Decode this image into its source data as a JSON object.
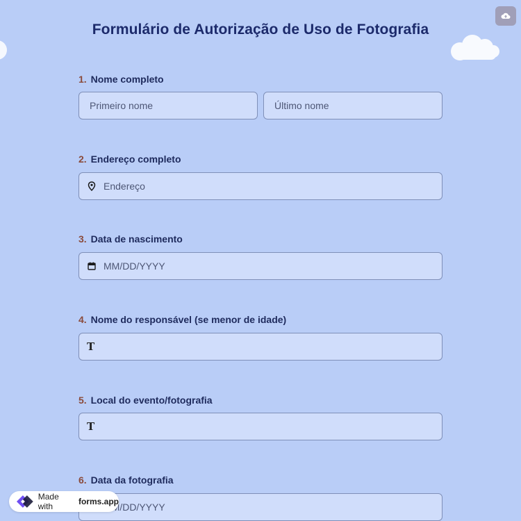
{
  "form": {
    "title": "Formulário de Autorização de Uso de Fotografia"
  },
  "questions": [
    {
      "num": "1.",
      "label": "Nome completo",
      "first_placeholder": "Primeiro nome",
      "last_placeholder": "Último nome"
    },
    {
      "num": "2.",
      "label": "Endereço completo",
      "placeholder": "Endereço",
      "icon": "location-pin-icon"
    },
    {
      "num": "3.",
      "label": "Data de nascimento",
      "placeholder": "MM/DD/YYYY",
      "icon": "calendar-icon"
    },
    {
      "num": "4.",
      "label": "Nome do responsável (se menor de idade)",
      "placeholder": "",
      "icon": "text-type-icon"
    },
    {
      "num": "5.",
      "label": "Local do evento/fotografia",
      "placeholder": "",
      "icon": "text-type-icon"
    },
    {
      "num": "6.",
      "label": "Data da fotografia",
      "placeholder": "MM/DD/YYYY",
      "icon": "calendar-icon"
    }
  ],
  "text_icon_glyph": "T",
  "badge": {
    "prefix": "Made with",
    "brand": "forms.app"
  },
  "colors": {
    "background": "#b9cdf7",
    "field": "#d0ddfb",
    "title": "#1c2a6b",
    "number": "#8a4a3a",
    "brand": "#6f4ef2"
  }
}
